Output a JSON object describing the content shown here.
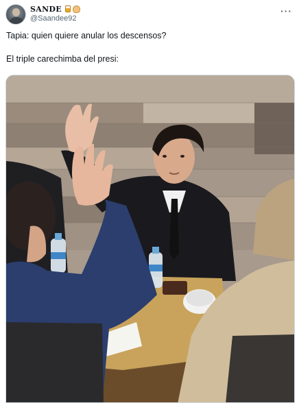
{
  "author": {
    "display_name": "SANDE",
    "handle": "@Saandee92",
    "emojis": [
      "beer-mug-icon",
      "raised-hand-icon"
    ]
  },
  "menu": {
    "more_label": "···"
  },
  "tweet": {
    "line1": "Tapia: quien quiere anular los descensos?",
    "line2": "El triple carechimba del presi:"
  },
  "media": {
    "image_icon": "photo-icon"
  },
  "colors": {
    "text": "#0f1419",
    "secondary": "#536471",
    "border": "#cfd9de"
  }
}
